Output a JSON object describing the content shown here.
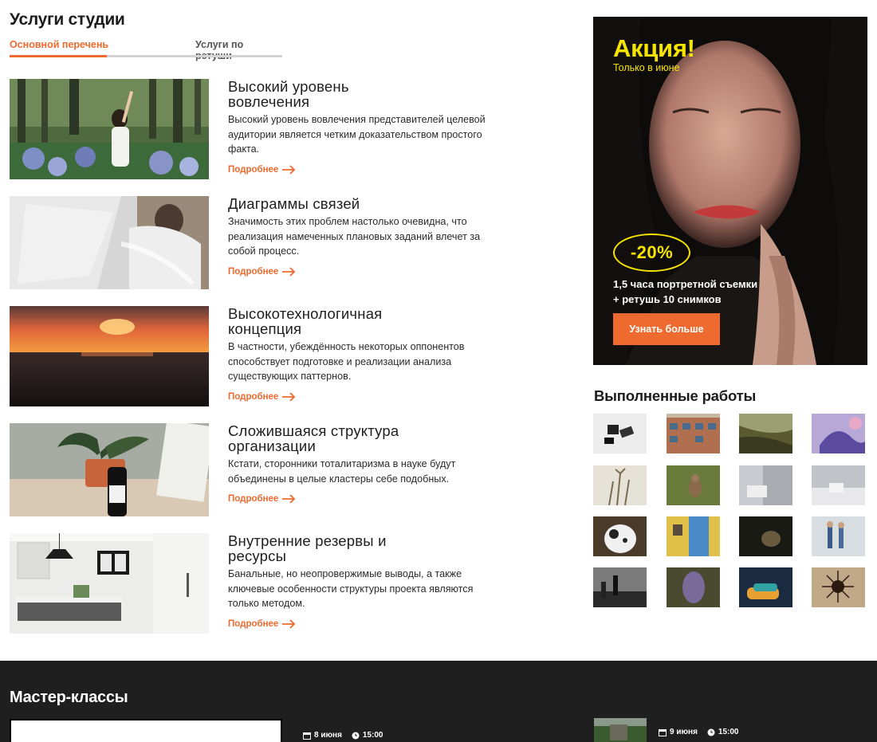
{
  "section": {
    "title": "Услуги студии",
    "tabs": [
      {
        "label": "Основной перечень",
        "active": true
      },
      {
        "label": "Услуги по ретуши",
        "active": false
      }
    ]
  },
  "services": [
    {
      "title": "Высокий уровень вовлечения",
      "description": "Высокий уровень вовлечения представителей целевой аудитории является четким доказательством простого факта.",
      "link": "Подробнее"
    },
    {
      "title": "Диаграммы связей",
      "description": "Значимость этих проблем настолько очевидна, что реализация намеченных плановых заданий влечет за собой процесс.",
      "link": "Подробнее"
    },
    {
      "title": "Высокотехнологичная концепция",
      "description": "В частности, убеждённость некоторых оппонентов способствует подготовке и реализации анализа существующих паттернов.",
      "link": "Подробнее"
    },
    {
      "title": "Сложившаяся структура организации",
      "description": "Кстати, сторонники тоталитаризма в науке будут объединены в целые кластеры себе подобных.",
      "link": "Подробнее"
    },
    {
      "title": "Внутренние резервы и ресурсы",
      "description": "Банальные, но неопровержимые выводы, а также ключевые особенности структуры проекта являются только методом.",
      "link": "Подробнее"
    }
  ],
  "promo": {
    "title": "Акция!",
    "subtitle": "Только в июне",
    "discount": "-20%",
    "description_line1": "1,5 часа портретной съемки",
    "description_line2": "+ ретушь 10 снимков",
    "button": "Узнать больше"
  },
  "works": {
    "title": "Выполненные работы",
    "count": 16
  },
  "masterclasses": {
    "title": "Мастер-классы",
    "items": [
      {
        "date": "8 июня",
        "time": "15:00"
      },
      {
        "date": "9 июня",
        "time": "15:00"
      }
    ]
  },
  "colors": {
    "accent": "#ef6a2e",
    "promo_yellow": "#f6e400",
    "dark_bg": "#1f1f1f"
  }
}
